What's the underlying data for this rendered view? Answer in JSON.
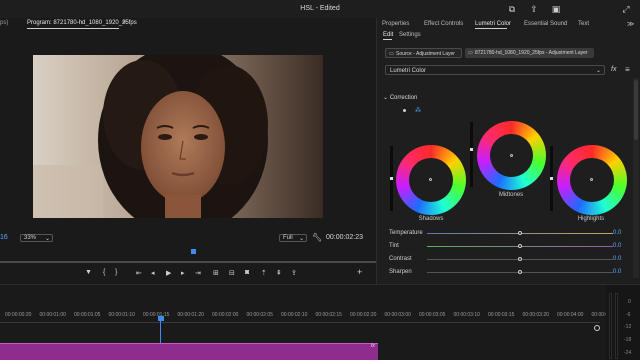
{
  "window": {
    "title": "HSL - Edited",
    "icons": [
      "adjust-icon",
      "share-icon",
      "quick-export-icon",
      "fullscreen-icon"
    ]
  },
  "program_monitor": {
    "left_tab_fragment": "ps)",
    "tab_label": "Program: 8721780-hd_1080_1920_25fps",
    "menu_glyph": "≡",
    "playhead_time_fragment": "16",
    "zoom_value": "33%",
    "quality_value": "Full",
    "timecode": "00:00:02:23",
    "controls": [
      "marker-icon",
      "in-point-icon",
      "out-point-icon",
      "go-to-in-icon",
      "step-back-icon",
      "play-icon",
      "step-forward-icon",
      "go-to-out-icon",
      "insert-icon",
      "overwrite-icon",
      "export-frame-icon",
      "lift-icon",
      "extract-icon",
      "add-icon"
    ]
  },
  "lumetri": {
    "tabs": [
      "Properties",
      "Effect Controls",
      "Lumetri Color",
      "Essential Sound",
      "Text"
    ],
    "active_tab": "Lumetri Color",
    "subtabs": [
      "Edit",
      "Settings"
    ],
    "source_label": "Source - Adjustment Layer",
    "target_label": "8721780-hd_1080_1920_25fps - Adjustment Layer",
    "effect_select": "Lumetri Color",
    "fx_label": "fx",
    "section": "Correction",
    "wheels": [
      {
        "label": "Shadows"
      },
      {
        "label": "Midtones"
      },
      {
        "label": "Highlights"
      }
    ],
    "sliders": [
      {
        "label": "Temperature",
        "value": "0.0",
        "color": "#c8a35a",
        "level": 0.5
      },
      {
        "label": "Tint",
        "value": "0.0",
        "color": "#9a5ab0",
        "level": 0.5
      },
      {
        "label": "Contrast",
        "value": "0.0",
        "color": "#555555",
        "level": 0.5
      },
      {
        "label": "Sharpen",
        "value": "0.0",
        "color": "#555555",
        "level": 0.5
      }
    ]
  },
  "timeline": {
    "ruler_labels": [
      "00:00:00:20",
      "00:00:01:00",
      "00:00:01:05",
      "00:00:01:10",
      "00:00:01:15",
      "00:00:01:20",
      "00:00:02:00",
      "00:00:02:05",
      "00:00:02:10",
      "00:00:02:15",
      "00:00:02:20",
      "00:00:03:00",
      "00:00:03:05",
      "00:00:03:10",
      "00:00:03:15",
      "00:00:03:20",
      "00:00:04:00",
      "00:00:0"
    ],
    "clip_fx": "fx",
    "meter_labels": [
      "0",
      "-6",
      "-12",
      "-18",
      "-24"
    ]
  },
  "colors": {
    "accent": "#3b8df0",
    "clip": "#8e2d8e",
    "value_blue": "#5ba7ff"
  }
}
